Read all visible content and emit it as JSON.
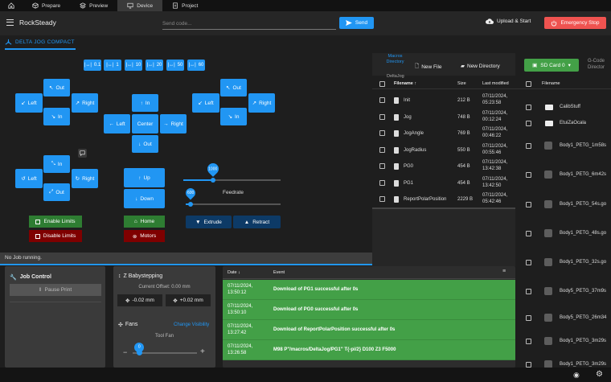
{
  "tabs": [
    {
      "label": "Prepare"
    },
    {
      "label": "Preview"
    },
    {
      "label": "Device"
    },
    {
      "label": "Project"
    }
  ],
  "toolbar": {
    "machine_name": "RockSteady",
    "code_placeholder": "Send code...",
    "send_label": "Send",
    "upload_label": "Upload & Start",
    "estop_label": "Emergency Stop"
  },
  "jog": {
    "title": "DELTA JOG COMPACT",
    "steps": [
      "0.1",
      "1",
      "10",
      "20",
      "50",
      "60"
    ],
    "out": "Out",
    "in": "In",
    "left": "Left",
    "right": "Right",
    "center": "Center",
    "up": "Up",
    "down": "Down",
    "limits_enable": "Enable Limits",
    "limits_disable": "Disable Limits",
    "home": "Home",
    "motors": "Motors",
    "feedrate_label": "Feedrate",
    "feed_value": "1000",
    "extrude_value": "600",
    "extrude": "Extrude",
    "retract": "Retract"
  },
  "status": "No Job running.",
  "files": {
    "tab_label": "Macros Directory",
    "path": "DeltaJog",
    "new_file": "New File",
    "new_dir": "New Directory",
    "headers": {
      "name": "Filename",
      "size": "Size",
      "modified": "Last modified"
    },
    "rows": [
      {
        "name": "Init",
        "size": "212 B",
        "date": "07/11/2024,",
        "time": "05:23:58"
      },
      {
        "name": "Jog",
        "size": "748 B",
        "date": "07/11/2024,",
        "time": "00:12:24"
      },
      {
        "name": "JogAngle",
        "size": "769 B",
        "date": "07/11/2024,",
        "time": "00:46:22"
      },
      {
        "name": "JogRadius",
        "size": "550 B",
        "date": "07/11/2024,",
        "time": "00:55:46"
      },
      {
        "name": "PG0",
        "size": "454 B",
        "date": "07/11/2024,",
        "time": "13:42:38"
      },
      {
        "name": "PG1",
        "size": "454 B",
        "date": "07/11/2024,",
        "time": "13:42:50"
      },
      {
        "name": "ReportPolarPosition",
        "size": "2229 B",
        "date": "07/11/2024,",
        "time": "05:42:46"
      }
    ]
  },
  "sd": {
    "card_label": "SD Card 0",
    "gcode_label": "G-Code Director",
    "header": "Filename",
    "rows": [
      "CalibStuff",
      "EtuiZaOcala",
      "Body1_PETG_1m58s",
      "Body1_PETG_6m42s",
      "Body1_PETG_54s.go",
      "Body1_PETG_48s.go",
      "Body1_PETG_32s.go",
      "Body5_PETG_37m9s",
      "Body5_PETG_26m34",
      "Body1_PETG_3m29s",
      "Body1_PETG_3m29s"
    ]
  },
  "job": {
    "title": "Job Control",
    "pause": "Pause Print"
  },
  "baby": {
    "title": "Z Babystepping",
    "offset": "Current Offset: 0.00 mm",
    "minus": "-0.02 mm",
    "plus": "+0.02 mm"
  },
  "fans": {
    "title": "Fans",
    "change": "Change Visibility",
    "tool_fan": "Tool Fan",
    "value": "0"
  },
  "log": {
    "date_header": "Date",
    "event_header": "Event",
    "rows": [
      {
        "date": "07/11/2024,",
        "time": "13:50:12",
        "event": "Download of PG1 successful after 0s"
      },
      {
        "date": "07/11/2024,",
        "time": "13:50:10",
        "event": "Download of PG0 successful after 0s"
      },
      {
        "date": "07/11/2024,",
        "time": "13:27:42",
        "event": "Download of ReportPolarPosition successful after 0s"
      },
      {
        "date": "07/11/2024,",
        "time": "13:26:58",
        "event": "M98 P\"/macros/DeltaJog/PG1\" T{-pi/2} D100 Z3 F5000"
      }
    ]
  }
}
